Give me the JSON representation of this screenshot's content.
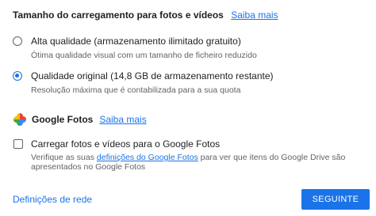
{
  "upload_size": {
    "title": "Tamanho do carregamento para fotos e vídeos",
    "learn_more": "Saiba mais",
    "options": [
      {
        "label": "Alta qualidade (armazenamento ilimitado gratuito)",
        "description": "Ótima qualidade visual com um tamanho de ficheiro reduzido",
        "selected": false
      },
      {
        "label": "Qualidade original (14,8 GB de armazenamento restante)",
        "description": "Resolução máxima que é contabilizada para a sua quota",
        "selected": true
      }
    ]
  },
  "google_photos": {
    "icon": "google-photos-pinwheel-icon",
    "title": "Google Fotos",
    "learn_more": "Saiba mais",
    "upload_checkbox": {
      "label": "Carregar fotos e vídeos para o Google Fotos",
      "checked": false,
      "desc_prefix": "Verifique as suas ",
      "desc_link": "definições do Google Fotos",
      "desc_suffix": " para ver que itens do Google Drive são apresentados no Google Fotos"
    }
  },
  "footer": {
    "network_settings": "Definições de rede",
    "next_button": "SEGUINTE"
  },
  "colors": {
    "accent": "#1a73e8",
    "text": "#202124",
    "secondary_text": "#5f6368"
  }
}
